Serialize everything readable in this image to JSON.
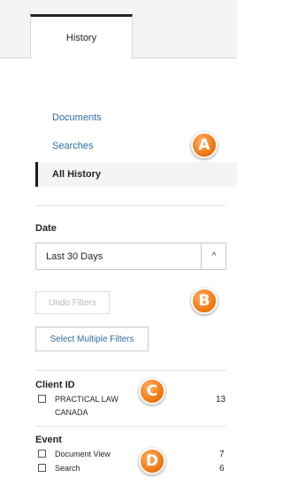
{
  "tabs": [
    {
      "label": "History"
    }
  ],
  "nav": {
    "items": [
      {
        "label": "Documents"
      },
      {
        "label": "Searches"
      },
      {
        "label": "All History",
        "active": true
      }
    ]
  },
  "date_filter": {
    "label": "Date",
    "selected": "Last 30 Days",
    "chevron": "^"
  },
  "buttons": {
    "undo_filters": "Undo Filters",
    "select_multiple": "Select Multiple Filters"
  },
  "client_id": {
    "heading": "Client ID",
    "items": [
      {
        "label_line1": "PRACTICAL LAW",
        "label_line2": "CANADA",
        "count": "13"
      }
    ]
  },
  "event": {
    "heading": "Event",
    "items": [
      {
        "label": "Document View",
        "count": "7"
      },
      {
        "label": "Search",
        "count": "6"
      }
    ]
  },
  "markers": [
    "A",
    "B",
    "C",
    "D"
  ],
  "colors": {
    "accent_link": "#2e6da4",
    "marker_orange": "#f07a14",
    "active_bar": "#1a1a1a"
  }
}
